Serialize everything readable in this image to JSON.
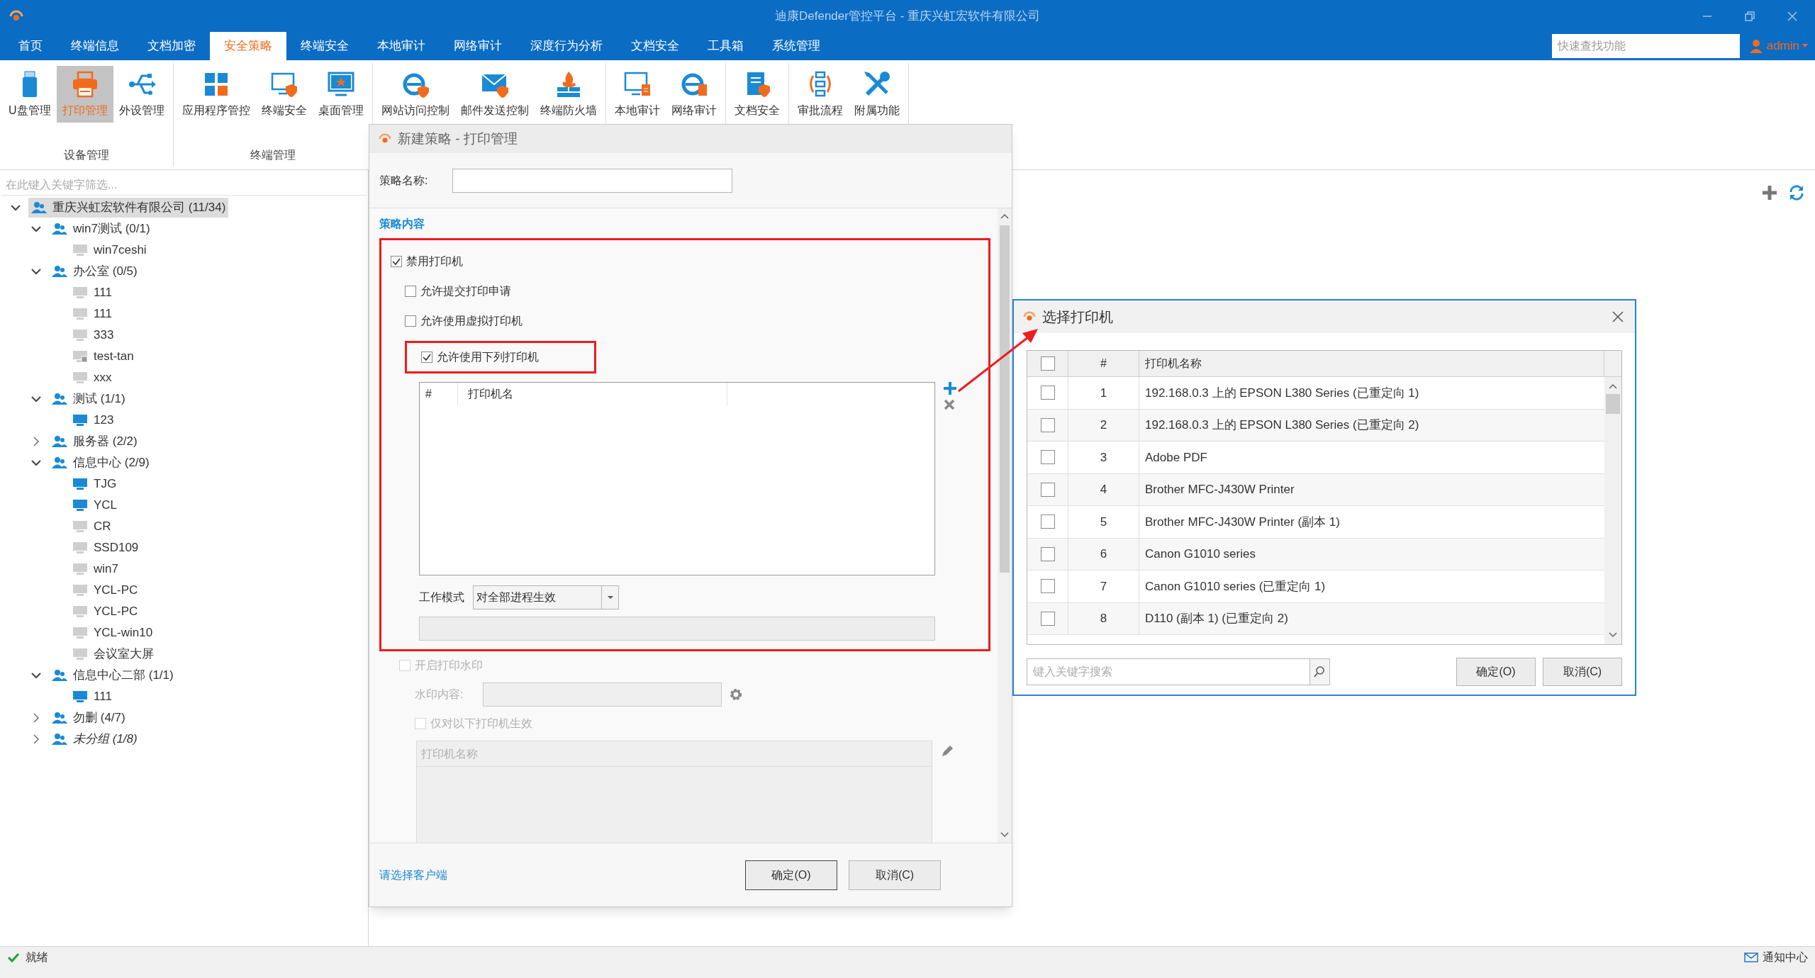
{
  "window": {
    "title": "迪康Defender管控平台 - 重庆兴虹宏软件有限公司"
  },
  "menu": [
    {
      "label": "首页",
      "selected": false
    },
    {
      "label": "终端信息",
      "selected": false
    },
    {
      "label": "文档加密",
      "selected": false
    },
    {
      "label": "安全策略",
      "selected": true
    },
    {
      "label": "终端安全",
      "selected": false
    },
    {
      "label": "本地审计",
      "selected": false
    },
    {
      "label": "网络审计",
      "selected": false
    },
    {
      "label": "深度行为分析",
      "selected": false
    },
    {
      "label": "文档安全",
      "selected": false
    },
    {
      "label": "工具箱",
      "selected": false
    },
    {
      "label": "系统管理",
      "selected": false
    }
  ],
  "quick_search": {
    "placeholder": "快速查找功能"
  },
  "user": {
    "name": "admin"
  },
  "toolbar": {
    "groups": [
      {
        "label": "设备管理",
        "items": [
          {
            "label": "U盘管理",
            "selected": false
          },
          {
            "label": "打印管理",
            "selected": true
          },
          {
            "label": "外设管理",
            "selected": false
          }
        ]
      },
      {
        "label": "终端管理",
        "items": [
          {
            "label": "应用程序管控",
            "selected": false
          },
          {
            "label": "终端安全",
            "selected": false
          },
          {
            "label": "桌面管理",
            "selected": false
          }
        ]
      },
      {
        "items": [
          {
            "label": "网站访问控制",
            "selected": false
          },
          {
            "label": "邮件发送控制",
            "selected": false
          },
          {
            "label": "终端防火墙",
            "selected": false
          }
        ]
      },
      {
        "items": [
          {
            "label": "本地审计",
            "selected": false
          },
          {
            "label": "网络审计",
            "selected": false
          }
        ]
      },
      {
        "items": [
          {
            "label": "文档安全",
            "selected": false
          }
        ]
      },
      {
        "items": [
          {
            "label": "审批流程",
            "selected": false
          },
          {
            "label": "附属功能",
            "selected": false
          }
        ]
      }
    ]
  },
  "tree": {
    "filter_placeholder": "在此键入关键字筛选...",
    "nodes": [
      {
        "label": "重庆兴虹宏软件有限公司 (11/34)",
        "kind": "group",
        "expanded": true,
        "selected": true,
        "children": [
          {
            "label": "win7测试 (0/1)",
            "kind": "group",
            "expanded": true,
            "selected": false,
            "children": [
              {
                "label": "win7ceshi",
                "kind": "computer",
                "online": false,
                "selected": false
              }
            ]
          },
          {
            "label": "办公室 (0/5)",
            "kind": "group",
            "expanded": true,
            "selected": false,
            "children": [
              {
                "label": "111",
                "kind": "computer",
                "online": false,
                "selected": false
              },
              {
                "label": "111",
                "kind": "computer",
                "online": false,
                "selected": false
              },
              {
                "label": "333",
                "kind": "computer",
                "online": false,
                "selected": false
              },
              {
                "label": "test-tan",
                "kind": "computer",
                "online": false,
                "locked": true,
                "selected": false
              },
              {
                "label": "xxx",
                "kind": "computer",
                "online": false,
                "selected": false
              }
            ]
          },
          {
            "label": "测试 (1/1)",
            "kind": "group",
            "expanded": true,
            "selected": false,
            "children": [
              {
                "label": "123",
                "kind": "computer",
                "online": true,
                "selected": false
              }
            ]
          },
          {
            "label": "服务器 (2/2)",
            "kind": "group",
            "expanded": false,
            "selected": false
          },
          {
            "label": "信息中心 (2/9)",
            "kind": "group",
            "expanded": true,
            "selected": false,
            "children": [
              {
                "label": "TJG",
                "kind": "computer",
                "online": true,
                "selected": false
              },
              {
                "label": "YCL",
                "kind": "computer",
                "online": true,
                "selected": false
              },
              {
                "label": "CR",
                "kind": "computer",
                "online": false,
                "selected": false
              },
              {
                "label": "SSD109",
                "kind": "computer",
                "online": false,
                "selected": false
              },
              {
                "label": "win7",
                "kind": "computer",
                "online": false,
                "selected": false
              },
              {
                "label": "YCL-PC",
                "kind": "computer",
                "online": false,
                "selected": false
              },
              {
                "label": "YCL-PC",
                "kind": "computer",
                "online": false,
                "selected": false
              },
              {
                "label": "YCL-win10",
                "kind": "computer",
                "online": false,
                "selected": false
              },
              {
                "label": "会议室大屏",
                "kind": "computer",
                "online": false,
                "selected": false
              }
            ]
          },
          {
            "label": "信息中心二部 (1/1)",
            "kind": "group",
            "expanded": true,
            "selected": false,
            "children": [
              {
                "label": "111",
                "kind": "computer",
                "online": true,
                "selected": false
              }
            ]
          },
          {
            "label": "勿删 (4/7)",
            "kind": "group",
            "expanded": false,
            "selected": false
          },
          {
            "label": "未分组 (1/8)",
            "kind": "group",
            "expanded": false,
            "italic": true,
            "selected": false
          }
        ]
      }
    ]
  },
  "policy_dialog": {
    "title": "新建策略 - 打印管理",
    "name_label": "策略名称:",
    "section_title": "策略内容",
    "options": [
      {
        "label": "禁用打印机",
        "checked": true,
        "children": [
          {
            "label": "允许提交打印申请",
            "checked": false
          },
          {
            "label": "允许使用虚拟打印机",
            "checked": false
          },
          {
            "label": "允许使用下列打印机",
            "checked": true,
            "highlighted": true
          }
        ]
      }
    ],
    "printer_list": {
      "columns": [
        "#",
        "打印机名"
      ]
    },
    "work_mode": {
      "label": "工作模式",
      "value": "对全部进程生效"
    },
    "watermark": {
      "label": "开启打印水印",
      "checked": false,
      "disabled": true,
      "content_label": "水印内容:",
      "only_label": "仅对以下打印机生效",
      "only_checked": false,
      "list_header": "打印机名称"
    },
    "footer_link": "请选择客户端",
    "buttons": [
      "确定(O)",
      "取消(C)"
    ]
  },
  "printer_dialog": {
    "title": "选择打印机",
    "select_all_checked": false,
    "columns": [
      "#",
      "打印机名称"
    ],
    "rows": [
      {
        "index": "1",
        "name": "192.168.0.3 上的 EPSON L380 Series (已重定向 1)",
        "checked": false
      },
      {
        "index": "2",
        "name": "192.168.0.3 上的 EPSON L380 Series (已重定向 2)",
        "checked": false
      },
      {
        "index": "3",
        "name": "Adobe PDF",
        "checked": false
      },
      {
        "index": "4",
        "name": "Brother MFC-J430W Printer",
        "checked": false
      },
      {
        "index": "5",
        "name": "Brother MFC-J430W Printer (副本 1)",
        "checked": false
      },
      {
        "index": "6",
        "name": "Canon G1010 series",
        "checked": false
      },
      {
        "index": "7",
        "name": "Canon G1010 series (已重定向 1)",
        "checked": false
      },
      {
        "index": "8",
        "name": "D110 (副本 1) (已重定向 2)",
        "checked": false
      }
    ],
    "search": {
      "placeholder": "键入关键字搜索"
    },
    "buttons": [
      "确定(O)",
      "取消(C)"
    ]
  },
  "status_bar": {
    "text": "就绪",
    "notifications": "通知中心"
  }
}
